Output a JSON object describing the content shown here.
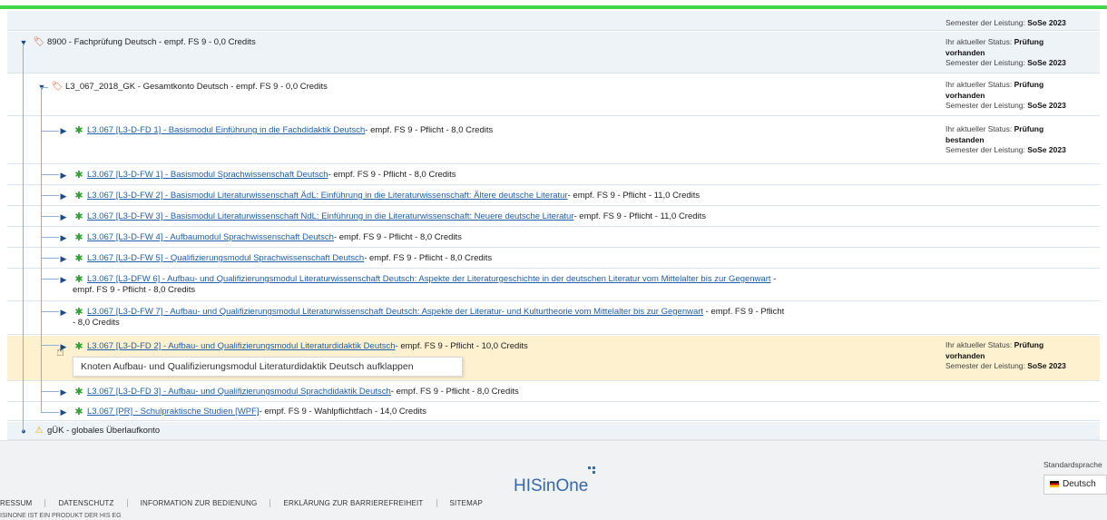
{
  "header": {
    "semester_label": "Semester der Leistung:",
    "semester_value": "SoSe 2023"
  },
  "tree": {
    "n0": {
      "label": "8900 - Fachprüfung Deutsch - empf. FS 9 - 0,0 Credits",
      "status_label": "Ihr aktueller Status:",
      "status_value_a": "Prüfung",
      "status_value_b": "vorhanden",
      "semester_label": "Semester der Leistung:",
      "semester_value": "SoSe 2023"
    },
    "n1": {
      "label": "L3_067_2018_GK - Gesamtkonto Deutsch - empf. FS 9 - 0,0 Credits",
      "status_label": "Ihr aktueller Status:",
      "status_value_a": "Prüfung",
      "status_value_b": "vorhanden",
      "semester_label": "Semester der Leistung:",
      "semester_value": "SoSe 2023"
    },
    "m1": {
      "link": "L3.067 [L3-D-FD 1] - Basismodul Einführung in die Fachdidaktik Deutsch",
      "rest": " - empf. FS 9 - Pflicht - 8,0 Credits",
      "status_label": "Ihr aktueller Status:",
      "status_value_a": "Prüfung",
      "status_value_b": "bestanden",
      "semester_label": "Semester der Leistung:",
      "semester_value": "SoSe 2023"
    },
    "m2": {
      "link": "L3.067 [L3-D-FW 1] - Basismodul Sprachwissenschaft Deutsch",
      "rest": " - empf. FS 9 - Pflicht - 8,0 Credits"
    },
    "m3": {
      "link": "L3.067 [L3-D-FW 2] - Basismodul Literaturwissenschaft ÄdL: Einführung in die Literaturwissenschaft: Ältere deutsche Literatur",
      "rest": " - empf. FS 9 - Pflicht - 11,0 Credits"
    },
    "m4": {
      "link": "L3.067 [L3-D-FW 3] - Basismodul Literaturwissenschaft NdL: Einführung in die Literaturwissenschaft: Neuere deutsche Literatur",
      "rest": " - empf. FS 9 - Pflicht - 11,0 Credits"
    },
    "m5": {
      "link": "L3.067 [L3-D-FW 4] - Aufbaumodul Sprachwissenschaft Deutsch",
      "rest": " - empf. FS 9 - Pflicht - 8,0 Credits"
    },
    "m6": {
      "link": "L3.067 [L3-D-FW 5] - Qualifizierungsmodul Sprachwissenschaft Deutsch",
      "rest": " - empf. FS 9 - Pflicht - 8,0 Credits"
    },
    "m7": {
      "link": "L3.067 [L3-DFW 6] - Aufbau- und Qualifizierungsmodul Literaturwissenschaft Deutsch: Aspekte der Literaturgeschichte in der deutschen Literatur vom Mittelalter bis zur Gegenwart",
      "rest": " -",
      "line2": "empf. FS 9 - Pflicht - 8,0 Credits"
    },
    "m8": {
      "link": "L3.067 [L3-D-FW 7] - Aufbau- und Qualifizierungsmodul Literaturwissenschaft Deutsch: Aspekte der Literatur- und Kulturtheorie vom Mittelalter bis zur Gegenwart",
      "rest": " - empf. FS 9 - Pflicht",
      "line2": "- 8,0 Credits"
    },
    "m9": {
      "link": "L3.067 [L3-D-FD 2] - Aufbau- und Qualifizierungsmodul Literaturdidaktik Deutsch",
      "rest": " - empf. FS 9 - Pflicht - 10,0 Credits",
      "status_label": "Ihr aktueller Status:",
      "status_value_a": "Prüfung",
      "status_value_b": "vorhanden",
      "semester_label": "Semester der Leistung:",
      "semester_value": "SoSe 2023"
    },
    "m10": {
      "link": "L3.067 [L3-D-FD 3] - Aufbau- und Qualifizierungsmodul Sprachdidaktik Deutsch",
      "rest": " - empf. FS 9 - Pflicht - 8,0 Credits"
    },
    "m11": {
      "link": "L3.067 [PR] - Schulpraktische Studien [WPF]",
      "rest": " - empf. FS 9 - Wahlpflichtfach - 14,0 Credits"
    },
    "g": {
      "label": "gÜK - globales Überlaufkonto"
    }
  },
  "tooltip": "Knoten Aufbau- und Qualifizierungsmodul Literaturdidaktik Deutsch aufklappen",
  "footer": {
    "logo": "HISinOne",
    "lang_label": "Standardsprache",
    "lang_value": "Deutsch",
    "links": [
      "RESSUM",
      "DATENSCHUTZ",
      "INFORMATION ZUR BEDIENUNG",
      "ERKLÄRUNG ZUR BARRIEREFREIHEIT",
      "SITEMAP"
    ],
    "copyright": "ISINONE IST EIN PRODUKT DER HIS EG"
  },
  "icons": {
    "expanded": "caret-down-icon",
    "collapsed": "caret-right-icon",
    "module": "puzzle-icon",
    "account": "tag-icon",
    "warning": "warning-icon"
  },
  "colors": {
    "accent_green": "#3fd54b",
    "link": "#1f5ea8",
    "highlight": "#fdf1cf",
    "row_blue": "#eef3f8"
  }
}
